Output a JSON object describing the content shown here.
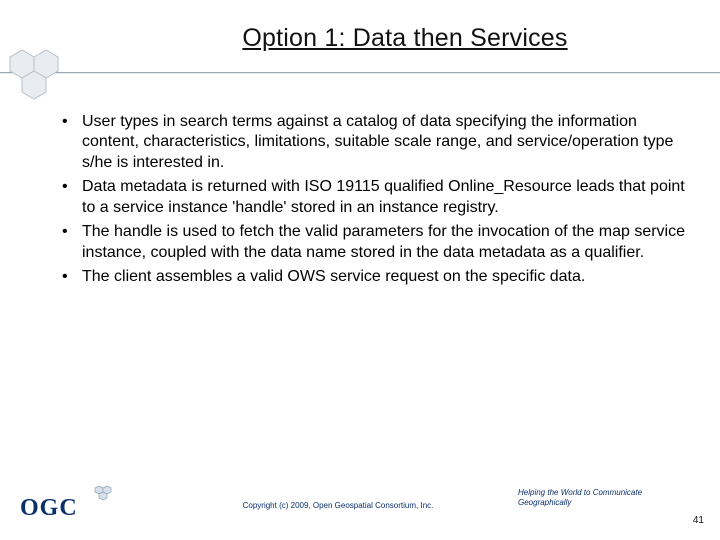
{
  "title": "Option 1: Data then Services",
  "bullets": [
    "User types in search terms against a catalog of data specifying the information content, characteristics, limitations, suitable scale range, and service/operation type s/he is interested in.",
    "Data metadata is returned with ISO 19115 qualified Online_Resource leads that point to a service instance 'handle' stored in an instance registry.",
    "The handle is used to fetch the valid parameters for the invocation of the map service instance, coupled with the data name stored in the data metadata as a qualifier.",
    "The client assembles a valid OWS service request on the specific data."
  ],
  "footer": {
    "logo_text": "OGC",
    "copyright": "Copyright (c) 2009, Open Geospatial Consortium, Inc.",
    "tagline": "Helping the World to Communicate Geographically",
    "page_number": "41"
  }
}
